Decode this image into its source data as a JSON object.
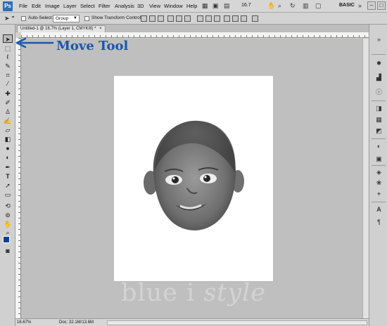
{
  "app": {
    "logo": "Ps",
    "menu": [
      "File",
      "Edit",
      "Image",
      "Layer",
      "Select",
      "Filter",
      "Analysis",
      "3D",
      "View",
      "Window",
      "Help"
    ],
    "zoom": "16.7",
    "workspace": "BASIC"
  },
  "options_bar": {
    "auto_select_label": "Auto-Select:",
    "auto_select_value": "Group",
    "show_transform_label": "Show Transform Controls"
  },
  "document": {
    "tab_title": "Untitled-1 @ 16.7% (Layer 1, CMYK/8) *",
    "tab_close": "×"
  },
  "status": {
    "zoom": "16.67%",
    "doc_size": "Doc: 32.1M/13.6M"
  },
  "annotation": {
    "label": "Move Tool",
    "color": "#1a57a8"
  },
  "watermark": {
    "part1": "blue i ",
    "part2": "style"
  },
  "colors": {
    "foreground": "#0b3e91",
    "canvas_bg": "#bfbfbf"
  }
}
